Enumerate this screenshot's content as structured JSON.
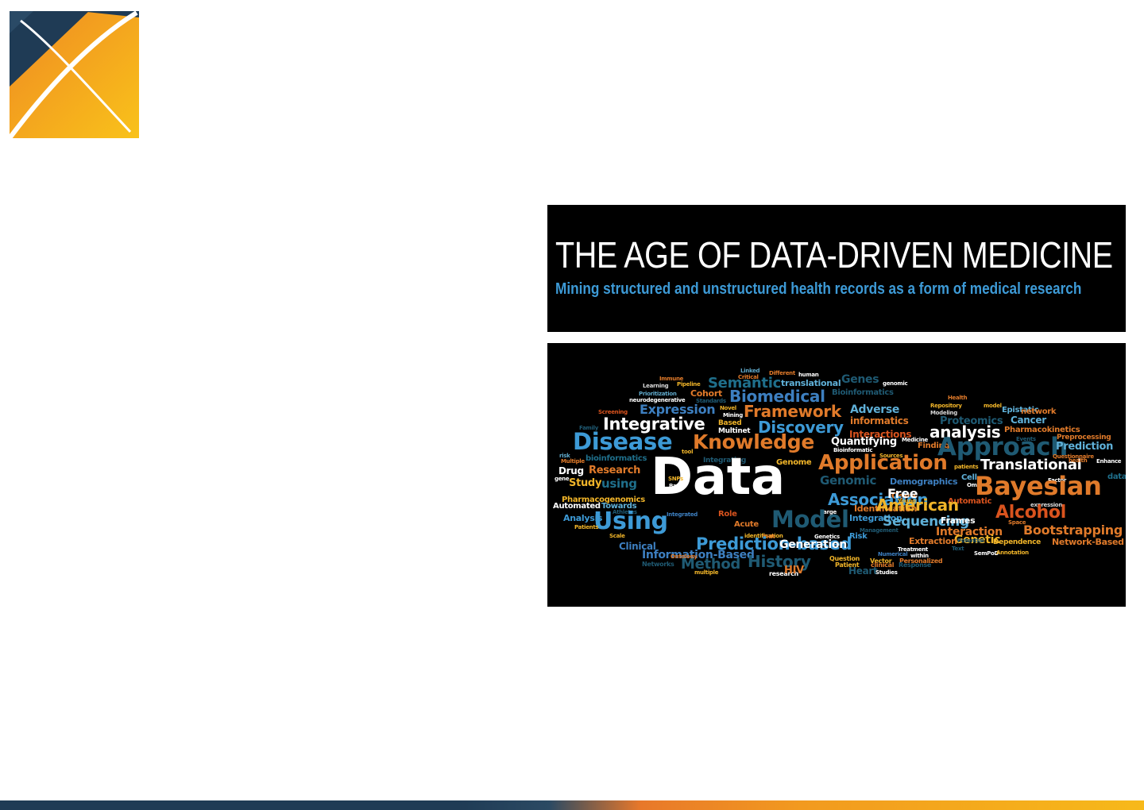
{
  "colors": {
    "navy": "#1f3b55",
    "orange": "#f29a1f",
    "yellow": "#f7b91a",
    "banner_subtitle": "#3d9ad6"
  },
  "logo": {
    "icon": "x-logo-icon"
  },
  "banner": {
    "title": "THE AGE OF DATA-DRIVEN MEDICINE",
    "subtitle": "Mining structured and unstructured health records as a form of medical research"
  },
  "word_cloud": {
    "words": [
      {
        "text": "Linked",
        "color": "#5fa8c9"
      },
      {
        "text": "Critical",
        "color": "#e07a2a"
      },
      {
        "text": "Different",
        "color": "#e07a2a"
      },
      {
        "text": "human",
        "color": "#ffffff"
      },
      {
        "text": "Immune",
        "color": "#e07a2a"
      },
      {
        "text": "Genes",
        "color": "#1f5a73"
      },
      {
        "text": "Learning",
        "color": "#d8d8d8"
      },
      {
        "text": "Pipeline",
        "color": "#f0b429"
      },
      {
        "text": "Semantic",
        "color": "#1f6f8b"
      },
      {
        "text": "translational",
        "color": "#5fb0d8"
      },
      {
        "text": "genomic",
        "color": "#ffffff"
      },
      {
        "text": "Prioritization",
        "color": "#5fa8c9"
      },
      {
        "text": "Cohort",
        "color": "#e07a2a"
      },
      {
        "text": "Bioinformatics",
        "color": "#1f5a73"
      },
      {
        "text": "neurodegenerative",
        "color": "#ffffff"
      },
      {
        "text": "Standards",
        "color": "#1f5a73"
      },
      {
        "text": "Biomedical",
        "color": "#3d7fc0"
      },
      {
        "text": "Health",
        "color": "#e07a2a"
      },
      {
        "text": "Novel",
        "color": "#f0b429"
      },
      {
        "text": "Repository",
        "color": "#f0b429"
      },
      {
        "text": "model",
        "color": "#f0b429"
      },
      {
        "text": "Screening",
        "color": "#d9531e"
      },
      {
        "text": "Expression",
        "color": "#3d7fc0"
      },
      {
        "text": "Mining",
        "color": "#ffffff"
      },
      {
        "text": "Framework",
        "color": "#e07a2a"
      },
      {
        "text": "Adverse",
        "color": "#5fb0d8"
      },
      {
        "text": "Modeling",
        "color": "#d8d8d8"
      },
      {
        "text": "Epistatic",
        "color": "#5fb0d8"
      },
      {
        "text": "network",
        "color": "#e07a2a"
      },
      {
        "text": "Integrative",
        "color": "#ffffff"
      },
      {
        "text": "Based",
        "color": "#f0b429"
      },
      {
        "text": "informatics",
        "color": "#e07a2a"
      },
      {
        "text": "Proteomics",
        "color": "#1f5a73"
      },
      {
        "text": "Cancer",
        "color": "#5fb0d8"
      },
      {
        "text": "Family",
        "color": "#1f5a73"
      },
      {
        "text": "Multinet",
        "color": "#ffffff"
      },
      {
        "text": "Discovery",
        "color": "#3d9ad6"
      },
      {
        "text": "Interactions",
        "color": "#d9531e"
      },
      {
        "text": "analysis",
        "color": "#ffffff"
      },
      {
        "text": "Pharmacokinetics",
        "color": "#e07a2a"
      },
      {
        "text": "Disease",
        "color": "#3d9ad6"
      },
      {
        "text": "Knowledge",
        "color": "#e07a2a"
      },
      {
        "text": "Quantifying",
        "color": "#ffffff"
      },
      {
        "text": "Medicine",
        "color": "#ffffff"
      },
      {
        "text": "Events",
        "color": "#1f5a73"
      },
      {
        "text": "Preprocessing",
        "color": "#e07a2a"
      },
      {
        "text": "Bioinformatic",
        "color": "#ffffff"
      },
      {
        "text": "Finding",
        "color": "#e07a2a"
      },
      {
        "text": "Approach",
        "color": "#1f5a73"
      },
      {
        "text": "Prediction",
        "color": "#5fb0d8"
      },
      {
        "text": "risk",
        "color": "#5fa8c9"
      },
      {
        "text": "tool",
        "color": "#f0b429"
      },
      {
        "text": "Sources",
        "color": "#f0b429"
      },
      {
        "text": "Questionnaire",
        "color": "#e07a2a"
      },
      {
        "text": "Multiple",
        "color": "#e07a2a"
      },
      {
        "text": "bioinformatics",
        "color": "#1f6f8b"
      },
      {
        "text": "Integrating",
        "color": "#1f5a73"
      },
      {
        "text": "Genome",
        "color": "#f0b429"
      },
      {
        "text": "Application",
        "color": "#e07a2a"
      },
      {
        "text": "Translational",
        "color": "#ffffff"
      },
      {
        "text": "health",
        "color": "#e07a2a"
      },
      {
        "text": "Enhance",
        "color": "#ffffff"
      },
      {
        "text": "Drug",
        "color": "#ffffff"
      },
      {
        "text": "Research",
        "color": "#e07a2a"
      },
      {
        "text": "Data",
        "color": "#ffffff"
      },
      {
        "text": "patients",
        "color": "#f0b429"
      },
      {
        "text": "Factor",
        "color": "#ffffff"
      },
      {
        "text": "data",
        "color": "#1f6f8b"
      },
      {
        "text": "gene",
        "color": "#ffffff"
      },
      {
        "text": "Study",
        "color": "#f0b429"
      },
      {
        "text": "using",
        "color": "#1f6f8b"
      },
      {
        "text": "SNPs",
        "color": "#f0b429"
      },
      {
        "text": "Base",
        "color": "#ffffff"
      },
      {
        "text": "Genomic",
        "color": "#1f5a73"
      },
      {
        "text": "Demographics",
        "color": "#3d7fc0"
      },
      {
        "text": "Cell",
        "color": "#5fb0d8"
      },
      {
        "text": "Omic",
        "color": "#ffffff"
      },
      {
        "text": "Bayesian",
        "color": "#e07a2a"
      },
      {
        "text": "Pharmacogenomics",
        "color": "#f0b429"
      },
      {
        "text": "Gene",
        "color": "#e07a2a"
      },
      {
        "text": "Association",
        "color": "#3d9ad6"
      },
      {
        "text": "Free",
        "color": "#ffffff"
      },
      {
        "text": "Young",
        "color": "#f0b429"
      },
      {
        "text": "Automatic",
        "color": "#d9531e"
      },
      {
        "text": "Automated",
        "color": "#ffffff"
      },
      {
        "text": "Towards",
        "color": "#5fb0d8"
      },
      {
        "text": "Identification",
        "color": "#e07a2a"
      },
      {
        "text": "American",
        "color": "#f0b429"
      },
      {
        "text": "expression",
        "color": "#d8d8d8"
      },
      {
        "text": "Athletes",
        "color": "#1f5a73"
      },
      {
        "text": "Integrated",
        "color": "#3d7fc0"
      },
      {
        "text": "Role",
        "color": "#d9531e"
      },
      {
        "text": "Large",
        "color": "#ffffff"
      },
      {
        "text": "Integration",
        "color": "#3d9ad6"
      },
      {
        "text": "Alcohol",
        "color": "#d9531e"
      },
      {
        "text": "Analysis",
        "color": "#3d9ad6"
      },
      {
        "text": "Using",
        "color": "#3d9ad6"
      },
      {
        "text": "Model",
        "color": "#1f5a73"
      },
      {
        "text": "Sequencing",
        "color": "#5fb0d8"
      },
      {
        "text": "Frames",
        "color": "#ffffff"
      },
      {
        "text": "Space",
        "color": "#e07a2a"
      },
      {
        "text": "Patients",
        "color": "#f0b429"
      },
      {
        "text": "Acute",
        "color": "#e07a2a"
      },
      {
        "text": "Management",
        "color": "#1f5a73"
      },
      {
        "text": "Risk",
        "color": "#3d9ad6"
      },
      {
        "text": "Interaction",
        "color": "#e07a2a"
      },
      {
        "text": "Genetic",
        "color": "#f0b429"
      },
      {
        "text": "Bootstrapping",
        "color": "#e07a2a"
      },
      {
        "text": "Scale",
        "color": "#f0b429"
      },
      {
        "text": "identification",
        "color": "#f0b429"
      },
      {
        "text": "EHR",
        "color": "#e07a2a"
      },
      {
        "text": "Genetics",
        "color": "#ffffff"
      },
      {
        "text": "Extraction",
        "color": "#e07a2a"
      },
      {
        "text": "Potential",
        "color": "#1f5a73"
      },
      {
        "text": "Dependence",
        "color": "#f0b429"
      },
      {
        "text": "Network-Based",
        "color": "#e07a2a"
      },
      {
        "text": "Clinical",
        "color": "#3d7fc0"
      },
      {
        "text": "Prediction-based",
        "color": "#3d9ad6"
      },
      {
        "text": "Generation",
        "color": "#ffffff"
      },
      {
        "text": "Treatment",
        "color": "#ffffff"
      },
      {
        "text": "Text",
        "color": "#1f5a73"
      },
      {
        "text": "Information-Based",
        "color": "#3d7fc0"
      },
      {
        "text": "Ontology",
        "color": "#e07a2a"
      },
      {
        "text": "Numerical",
        "color": "#3d7fc0"
      },
      {
        "text": "within",
        "color": "#ffffff"
      },
      {
        "text": "SemPoD",
        "color": "#ffffff"
      },
      {
        "text": "Annotation",
        "color": "#f0b429"
      },
      {
        "text": "Question",
        "color": "#f0b429"
      },
      {
        "text": "Vector",
        "color": "#f0b429"
      },
      {
        "text": "Personalized",
        "color": "#e07a2a"
      },
      {
        "text": "Networks",
        "color": "#1f5a73"
      },
      {
        "text": "Method",
        "color": "#1f5a73"
      },
      {
        "text": "History",
        "color": "#1f5a73"
      },
      {
        "text": "Patient",
        "color": "#f0b429"
      },
      {
        "text": "clinical",
        "color": "#e07a2a"
      },
      {
        "text": "Response",
        "color": "#1f5a73"
      },
      {
        "text": "multiple",
        "color": "#f0b429"
      },
      {
        "text": "research",
        "color": "#ffffff"
      },
      {
        "text": "HIV",
        "color": "#e07a2a"
      },
      {
        "text": "Heart",
        "color": "#1f5a73"
      },
      {
        "text": "Studies",
        "color": "#ffffff"
      }
    ]
  }
}
